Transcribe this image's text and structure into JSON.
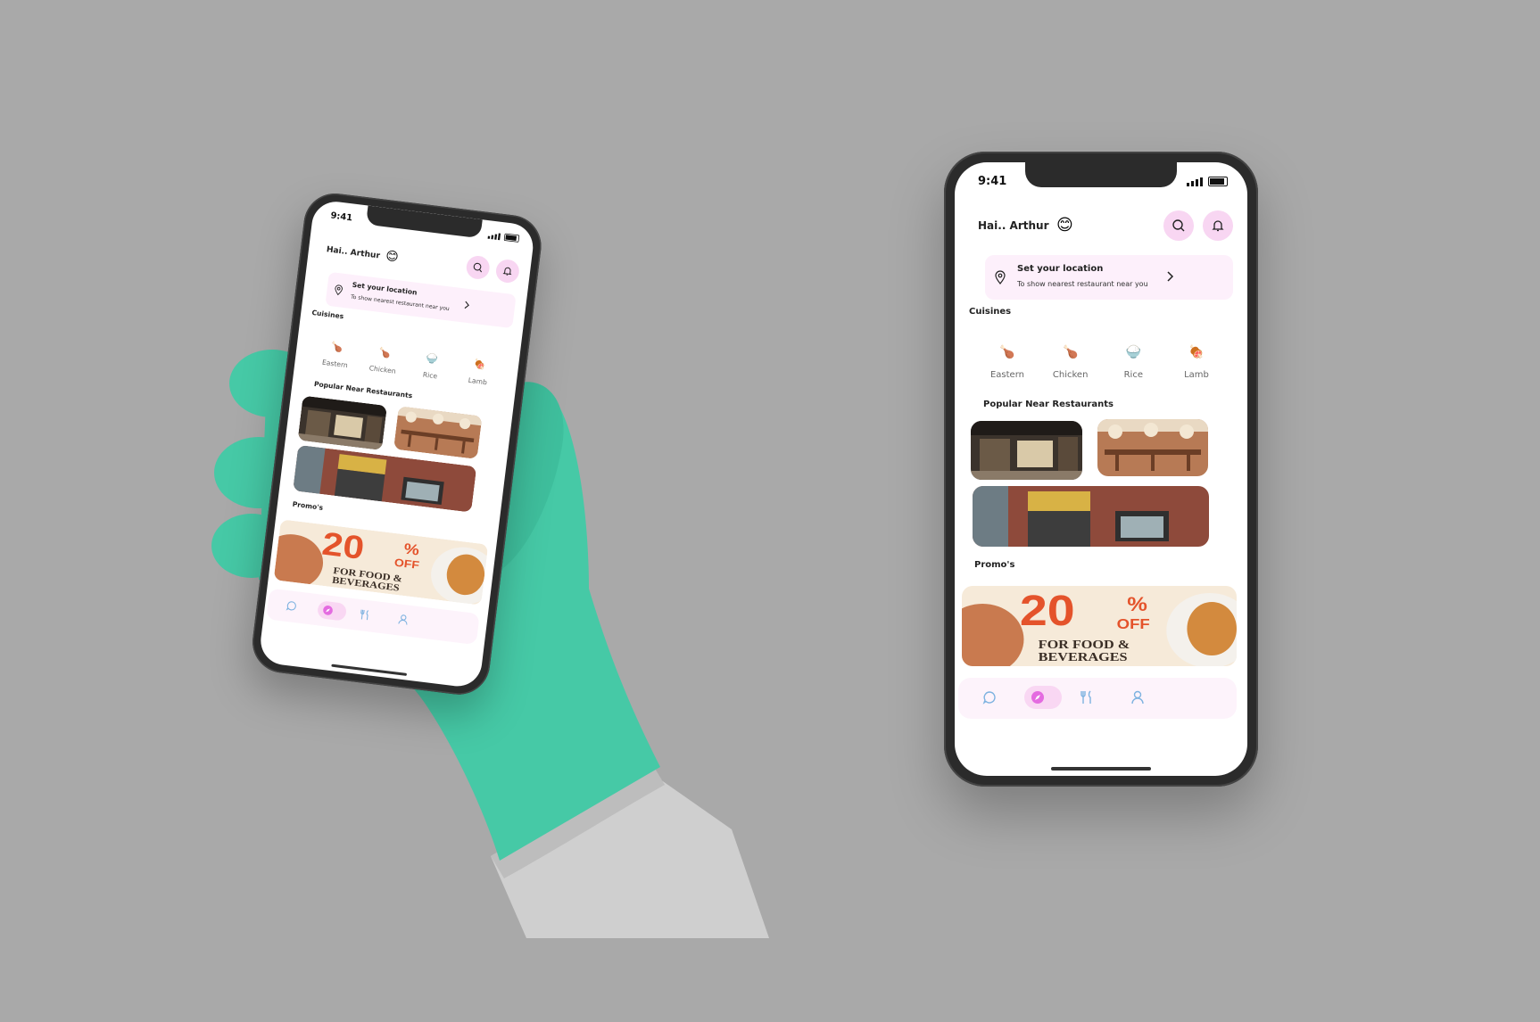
{
  "status": {
    "time": "9:41"
  },
  "header": {
    "greeting": "Hai.. Arthur",
    "emoji": "😊"
  },
  "location": {
    "title": "Set your location",
    "subtitle": "To show nearest restaurant near you"
  },
  "cuisines": {
    "title": "Cuisines",
    "items": [
      {
        "label": "Eastern",
        "icon": "🍗"
      },
      {
        "label": "Chicken",
        "icon": "🍗"
      },
      {
        "label": "Rice",
        "icon": "🍚"
      },
      {
        "label": "Lamb",
        "icon": "🍖"
      }
    ]
  },
  "popular": {
    "title": "Popular Near Restaurants"
  },
  "promos": {
    "title": "Promo's",
    "banner": {
      "big": "20",
      "percent": "%",
      "off": "OFF",
      "line1": "FOR FOOD &",
      "line2": "BEVERAGES"
    }
  },
  "tabbar": {
    "items": [
      "chat",
      "explore",
      "restaurants",
      "profile"
    ],
    "active": "explore"
  },
  "colors": {
    "background": "#a9a9a9",
    "accent": "#f8d6f2",
    "accent_strong": "#e46be0",
    "glove": "#46c9a6",
    "sleeve": "#cfcfcf"
  }
}
